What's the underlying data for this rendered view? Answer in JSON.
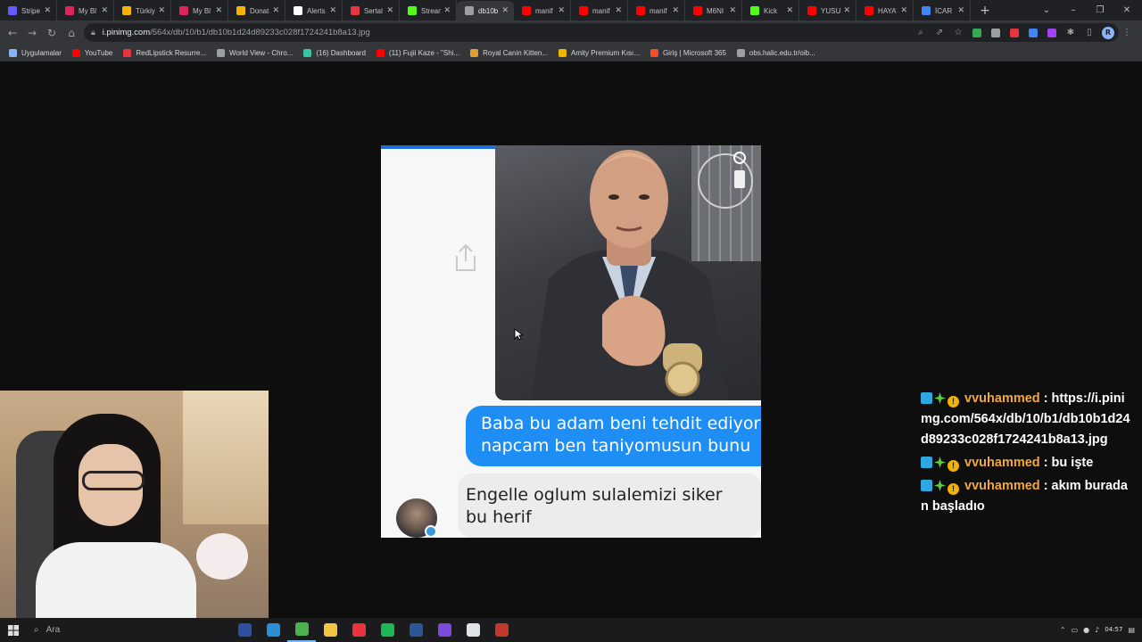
{
  "browser": {
    "tabs": [
      {
        "label": "Stripe",
        "color": "#635bff",
        "active": false
      },
      {
        "label": "My Bl",
        "color": "#e0245e",
        "active": false
      },
      {
        "label": "Türkiy",
        "color": "#f4b400",
        "active": false
      },
      {
        "label": "My Bl",
        "color": "#e0245e",
        "active": false
      },
      {
        "label": "Donat",
        "color": "#f4b400",
        "active": false
      },
      {
        "label": "Alerts",
        "color": "#ffffff",
        "active": false
      },
      {
        "label": "Sertal",
        "color": "#e8343c",
        "active": false
      },
      {
        "label": "Stream",
        "color": "#53fc18",
        "active": false
      },
      {
        "label": "db10b",
        "color": "#9aa0a6",
        "active": true
      },
      {
        "label": "manif",
        "color": "#ff0000",
        "active": false
      },
      {
        "label": "manif",
        "color": "#ff0000",
        "active": false
      },
      {
        "label": "manif",
        "color": "#ff0000",
        "active": false
      },
      {
        "label": "M6NI",
        "color": "#ff0000",
        "active": false
      },
      {
        "label": "Kick",
        "color": "#53fc18",
        "active": false
      },
      {
        "label": "YUSU",
        "color": "#ff0000",
        "active": false
      },
      {
        "label": "HAYA",
        "color": "#ff0000",
        "active": false
      },
      {
        "label": "İCAR",
        "color": "#4285f4",
        "active": false
      }
    ],
    "new_tab": "+",
    "window_controls": {
      "chevron": "⌄",
      "minimize": "–",
      "restore": "❐",
      "close": "✕"
    },
    "nav": {
      "back": "←",
      "forward": "→",
      "reload": "↻",
      "home": "⌂"
    },
    "url_host": "i.pinimg.com",
    "url_path": "/564x/db/10/b1/db10b1d24d89233c028f1724241b8a13.jpg",
    "profile_initial": "R",
    "bookmarks": [
      {
        "label": "Uygulamalar",
        "color": "#8ab4f8"
      },
      {
        "label": "YouTube",
        "color": "#ff0000"
      },
      {
        "label": "RedLipstick Resurre...",
        "color": "#e8343c"
      },
      {
        "label": "World View - Chro...",
        "color": "#9aa0a6"
      },
      {
        "label": "(16) Dashboard",
        "color": "#36c5a0"
      },
      {
        "label": "(11) Fujii Kaze - \"Shi...",
        "color": "#ff0000"
      },
      {
        "label": "Royal Canin Kitten...",
        "color": "#e0a030"
      },
      {
        "label": "Amity Premium Kısı...",
        "color": "#f4b400"
      },
      {
        "label": "Giriş | Microsoft 365",
        "color": "#f25022"
      },
      {
        "label": "obs.halic.edu.tr/oib...",
        "color": "#9aa0a6"
      }
    ]
  },
  "meme": {
    "blue_line1": "Baba bu adam beni tehdit ediyor",
    "blue_line2": "napcam ben taniyomusun bunu",
    "gray_line1": "Engelle oglum sulalemizi siker",
    "gray_line2": "bu herif"
  },
  "chat": [
    {
      "user": "vvuhammed",
      "text": ": https://i.pinimg.com/564x/db/10/b1/db10b1d24d89233c028f1724241b8a13.jpg"
    },
    {
      "user": "vvuhammed",
      "text": ": bu işte"
    },
    {
      "user": "vvuhammed",
      "text": ": akım buradan başladıo"
    }
  ],
  "taskbar": {
    "search_placeholder": "Ara",
    "clock_time": "04:57",
    "apps": [
      {
        "name": "tools-app",
        "color": "#2f4f9f"
      },
      {
        "name": "edge-app",
        "color": "#2b8fd6"
      },
      {
        "name": "chrome-app",
        "color": "#4caf50"
      },
      {
        "name": "explorer-app",
        "color": "#f4c542"
      },
      {
        "name": "voice-app",
        "color": "#e8343c"
      },
      {
        "name": "spotify-app",
        "color": "#1db954"
      },
      {
        "name": "word-app",
        "color": "#2b5797"
      },
      {
        "name": "discord-app",
        "color": "#7a4cd9"
      },
      {
        "name": "obs-app",
        "color": "#dfe3e8"
      },
      {
        "name": "misc-app",
        "color": "#c0392b"
      }
    ]
  }
}
